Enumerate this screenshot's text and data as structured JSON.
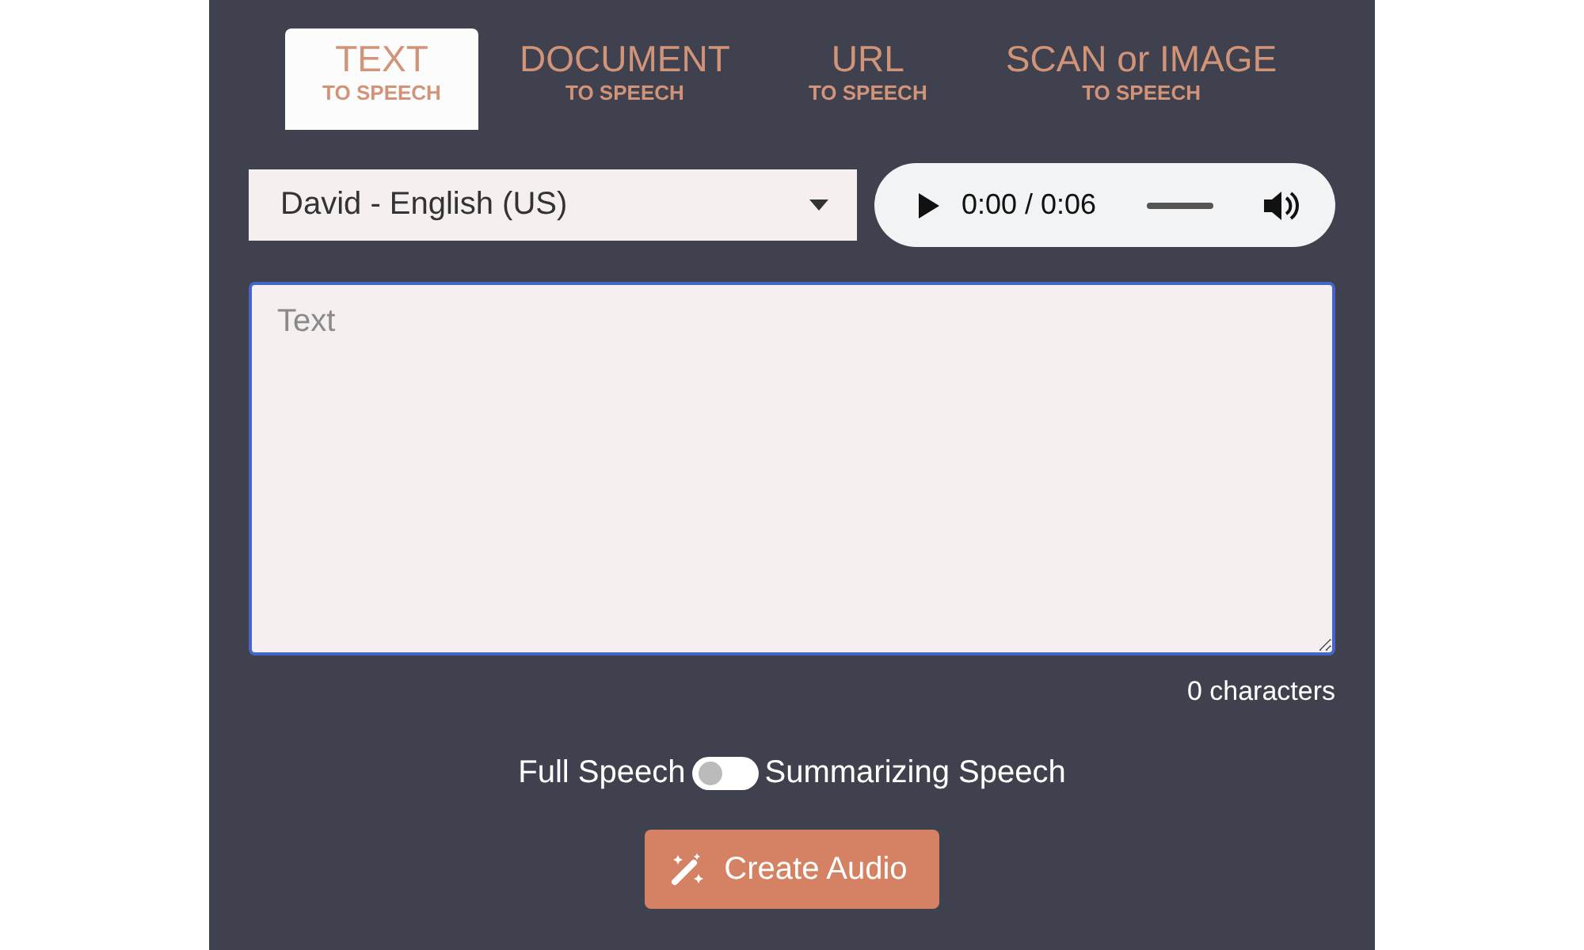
{
  "tabs": [
    {
      "title": "TEXT",
      "subtitle": "TO SPEECH",
      "selected": true
    },
    {
      "title": "DOCUMENT",
      "subtitle": "TO SPEECH",
      "selected": false
    },
    {
      "title": "URL",
      "subtitle": "TO SPEECH",
      "selected": false
    },
    {
      "title": "SCAN or IMAGE",
      "subtitle": "TO SPEECH",
      "selected": false
    }
  ],
  "voice_select": {
    "value": "David - English (US)"
  },
  "audio_player": {
    "time": "0:00 / 0:06",
    "level": 0
  },
  "text_input": {
    "placeholder": "Text"
  },
  "char_count": "0 characters",
  "mode_toggle": {
    "left_label": "Full Speech",
    "right_label": "Summarizing Speech",
    "on": false
  },
  "create_button": {
    "label": "Create Audio"
  }
}
